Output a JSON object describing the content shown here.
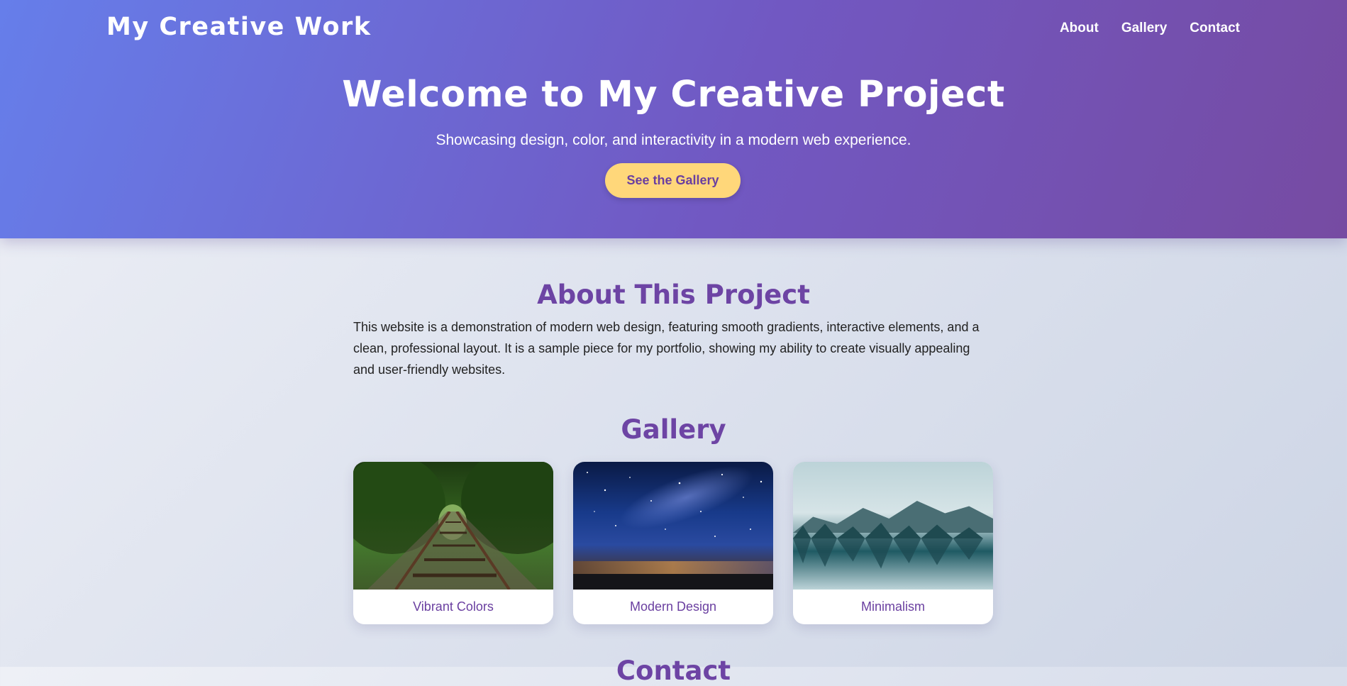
{
  "header": {
    "brand": "My Creative Work",
    "nav": [
      {
        "label": "About"
      },
      {
        "label": "Gallery"
      },
      {
        "label": "Contact"
      }
    ],
    "title": "Welcome to My Creative Project",
    "subtitle": "Showcasing design, color, and interactivity in a modern web experience.",
    "cta_label": "See the Gallery"
  },
  "about": {
    "title": "About This Project",
    "text": "This website is a demonstration of modern web design, featuring smooth gradients, interactive elements, and a clean, professional layout. It is a sample piece for my portfolio, showing my ability to create visually appealing and user-friendly websites."
  },
  "gallery": {
    "title": "Gallery",
    "items": [
      {
        "caption": "Vibrant Colors",
        "image": "forest-railway-photo"
      },
      {
        "caption": "Modern Design",
        "image": "starry-night-photo"
      },
      {
        "caption": "Minimalism",
        "image": "mountain-lake-photo"
      }
    ]
  },
  "contact": {
    "title": "Contact"
  },
  "colors": {
    "hero_gradient_start": "#667eea",
    "hero_gradient_end": "#764ba2",
    "accent": "#6d44a4",
    "cta_background": "#ffd77a"
  }
}
